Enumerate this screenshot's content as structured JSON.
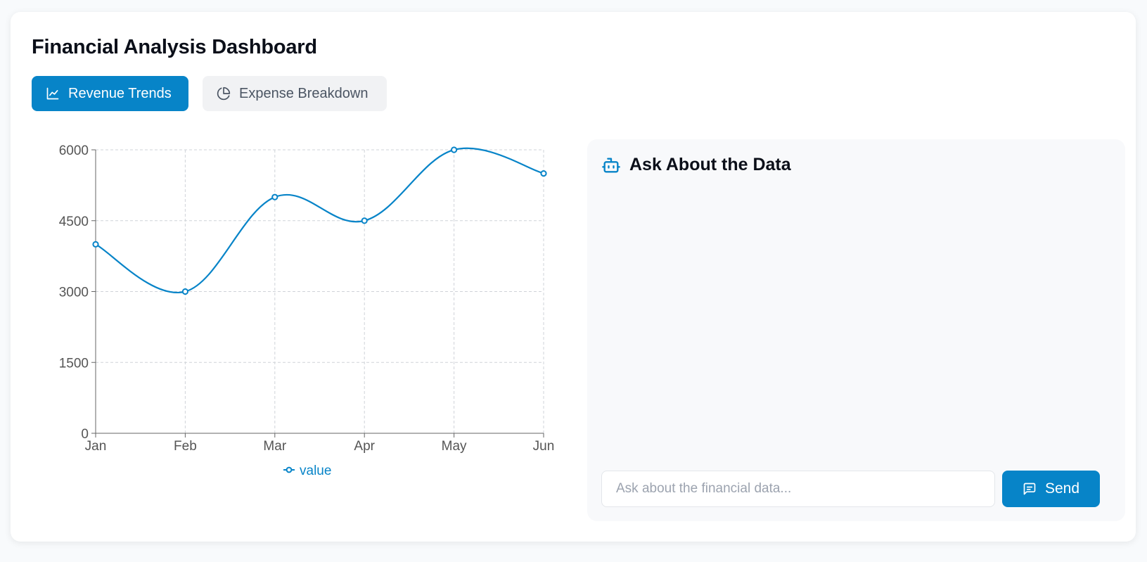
{
  "page": {
    "title": "Financial Analysis Dashboard"
  },
  "tabs": [
    {
      "label": "Revenue Trends",
      "icon": "line-chart-icon",
      "active": true
    },
    {
      "label": "Expense Breakdown",
      "icon": "pie-chart-icon",
      "active": false
    }
  ],
  "colors": {
    "accent": "#0784c8",
    "grid": "#cfd3d8",
    "axis": "#666666",
    "tick_text": "#555555"
  },
  "chart_data": {
    "type": "line",
    "categories": [
      "Jan",
      "Feb",
      "Mar",
      "Apr",
      "May",
      "Jun"
    ],
    "series": [
      {
        "name": "value",
        "values": [
          4000,
          3000,
          5000,
          4500,
          6000,
          5500
        ]
      }
    ],
    "yticks": [
      0,
      1500,
      3000,
      4500,
      6000
    ],
    "ylim": [
      0,
      6000
    ],
    "grid": true,
    "legend": "bottom-center"
  },
  "chat": {
    "title": "Ask About the Data",
    "icon": "robot-icon",
    "input_placeholder": "Ask about the financial data...",
    "input_value": "",
    "send_label": "Send",
    "send_icon": "message-icon"
  }
}
